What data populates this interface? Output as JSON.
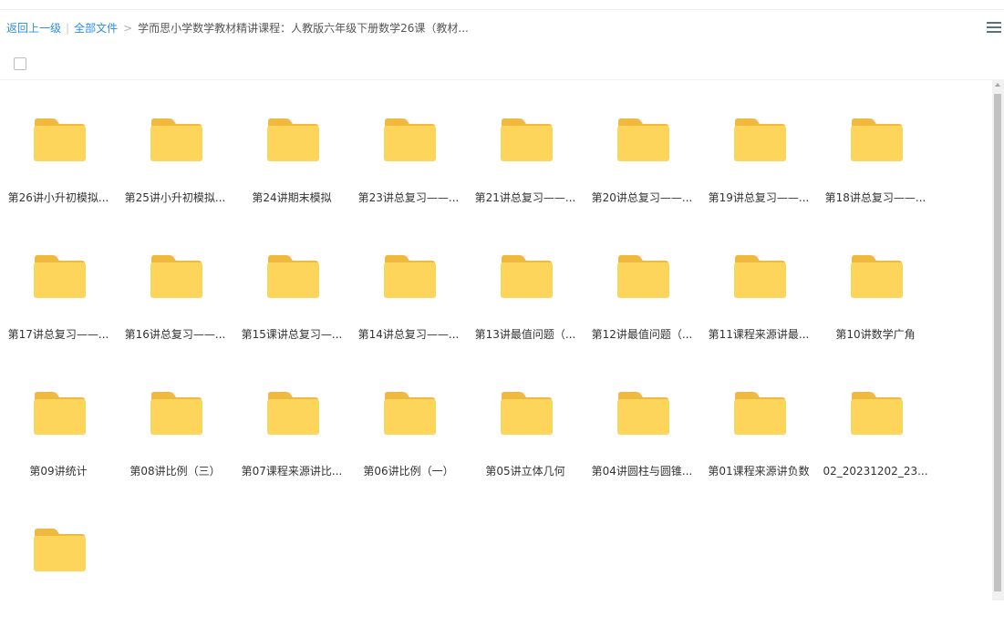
{
  "breadcrumb": {
    "back": "返回上一级",
    "separator_bar": "|",
    "root": "全部文件",
    "separator_arrow": ">",
    "current": "学而思小学数学教材精讲课程：人教版六年级下册数学26课（教材..."
  },
  "toolbar": {
    "menu_icon": "hamburger-menu-icon"
  },
  "select_all": {
    "checked": false
  },
  "folder_colors": {
    "body": "#fdd55a",
    "tab": "#efb93f"
  },
  "files": [
    {
      "name": "第26讲小升初模拟..."
    },
    {
      "name": "第25讲小升初模拟..."
    },
    {
      "name": "第24讲期末模拟"
    },
    {
      "name": "第23讲总复习——..."
    },
    {
      "name": "第21讲总复习——..."
    },
    {
      "name": "第20讲总复习——..."
    },
    {
      "name": "第19讲总复习——..."
    },
    {
      "name": "第18讲总复习——..."
    },
    {
      "name": "第17讲总复习——..."
    },
    {
      "name": "第16讲总复习——..."
    },
    {
      "name": "第15课讲总复习—..."
    },
    {
      "name": "第14讲总复习——..."
    },
    {
      "name": "第13讲最值问题（..."
    },
    {
      "name": "第12讲最值问题（..."
    },
    {
      "name": "第11课程来源讲最..."
    },
    {
      "name": "第10讲数学广角"
    },
    {
      "name": "第09讲统计"
    },
    {
      "name": "第08讲比例（三）"
    },
    {
      "name": "第07课程来源讲比..."
    },
    {
      "name": "第06讲比例（一）"
    },
    {
      "name": "第05讲立体几何"
    },
    {
      "name": "第04讲圆柱与圆锥..."
    },
    {
      "name": "第01课程来源讲负数"
    },
    {
      "name": "02_20231202_23..."
    },
    {
      "name": ""
    }
  ]
}
